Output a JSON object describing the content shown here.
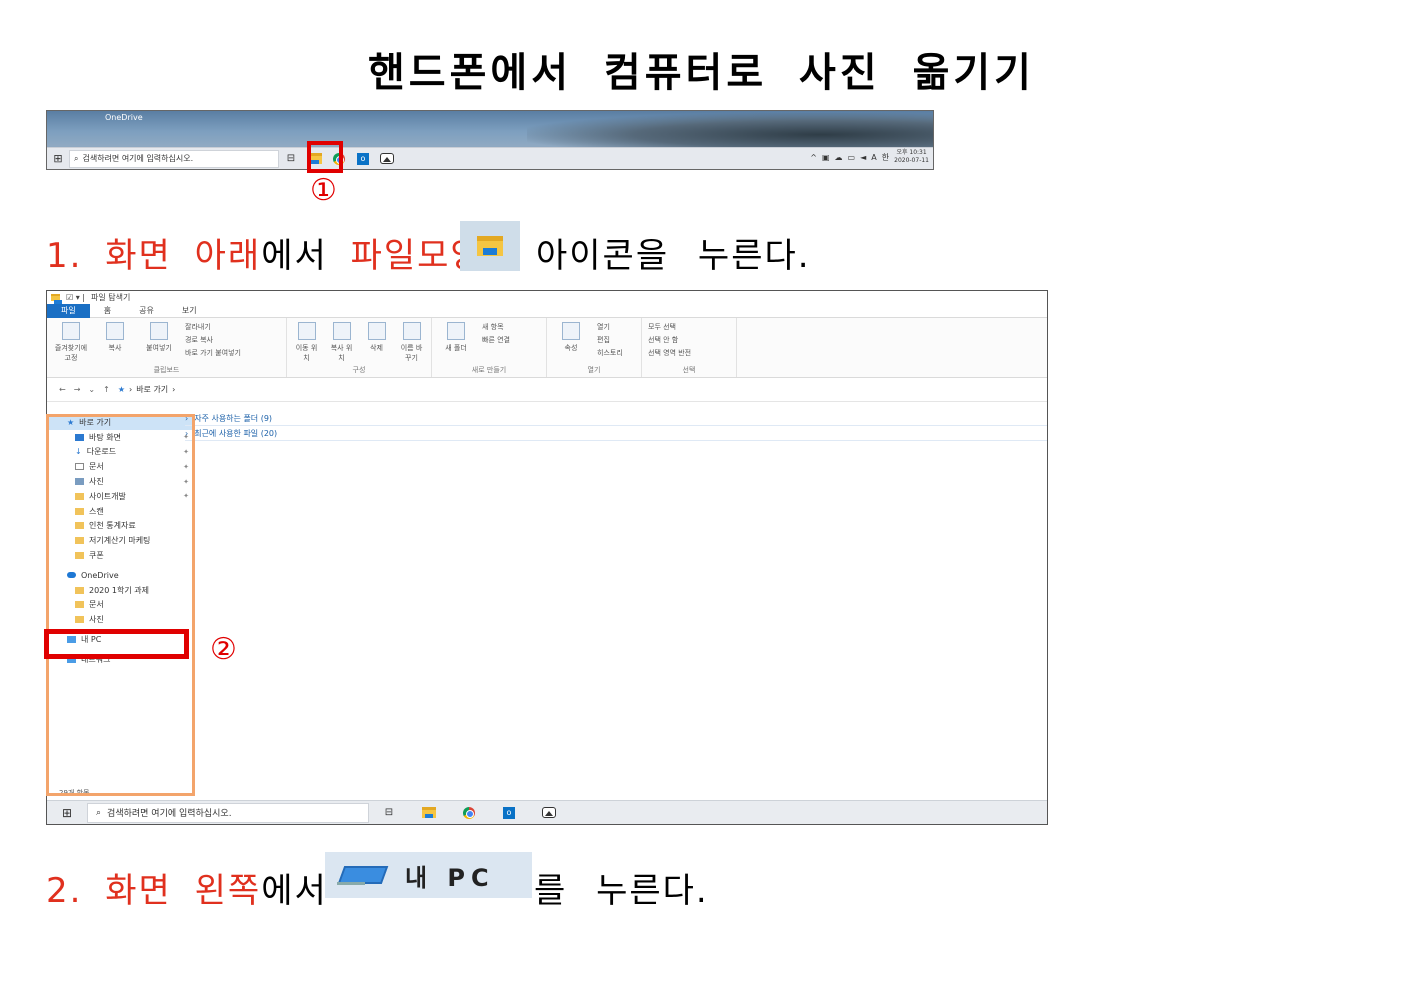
{
  "title": "핸드폰에서 컴퓨터로 사진 옮기기",
  "taskbar_shot": {
    "desktop_label": "OneDrive",
    "search_placeholder": "검색하려면 여기에 입력하십시오.",
    "tray_ime": "A",
    "tray_lang": "한",
    "clock_time": "오후 10:31",
    "clock_date": "2020-07-11"
  },
  "marker1": "①",
  "step1": {
    "number": "1.",
    "red1": "화면",
    "red2": "아래",
    "text1": "에서",
    "red3": "파일모양",
    "text2": "아이콘을 누른다."
  },
  "explorer_shot": {
    "window_title": "파일 탐색기",
    "tabs": [
      "파일",
      "홈",
      "공유",
      "보기"
    ],
    "ribbon": {
      "clipboard": {
        "pin": "즐겨찾기에 고정",
        "copy": "복사",
        "paste": "붙여넣기",
        "cut": "잘라내기",
        "copy_path": "경로 복사",
        "paste_shortcut": "바로 가기 붙여넣기",
        "group": "클립보드"
      },
      "organize": {
        "move_to": "이동 위치",
        "copy_to": "복사 위치",
        "delete": "삭제",
        "rename": "이름 바꾸기",
        "group": "구성"
      },
      "new": {
        "new_folder": "새 폴더",
        "new_item": "새 항목",
        "easy_access": "빠른 연결",
        "group": "새로 만들기"
      },
      "open": {
        "properties": "속성",
        "open": "열기",
        "edit": "편집",
        "history": "히스토리",
        "group": "열기"
      },
      "select": {
        "select_all": "모두 선택",
        "select_none": "선택 안 함",
        "invert": "선택 영역 반전",
        "group": "선택"
      }
    },
    "address_path": "바로 가기",
    "nav_items": [
      "바로 가기",
      "바탕 화면",
      "다운로드",
      "문서",
      "사진",
      "사이트개발",
      "스캔",
      "인천 통계자료",
      "저기계산기 마케팅",
      "쿠폰",
      "OneDrive",
      "2020 1학기 과제",
      "문서",
      "사진",
      "내 PC",
      "네트워크"
    ],
    "content_groups": [
      "자주 사용하는 폴더 (9)",
      "최근에 사용한 파일 (20)"
    ],
    "status": "29개 항목",
    "search_placeholder": "검색하려면 여기에 입력하십시오."
  },
  "marker2": "②",
  "step2": {
    "number": "2.",
    "red1": "화면",
    "red2": "왼쪽",
    "text1": "에서",
    "pc_label": "내 PC",
    "text2": "를 누른다."
  }
}
